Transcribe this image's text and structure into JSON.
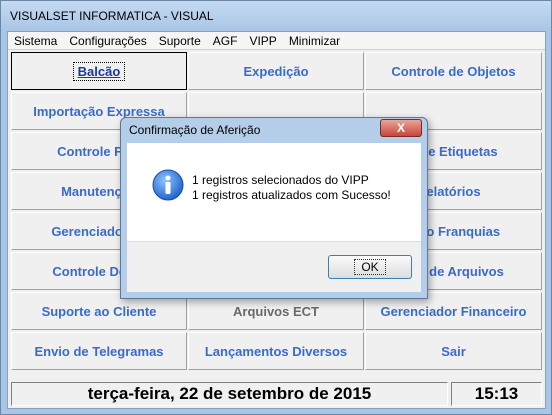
{
  "window": {
    "title": "VISUALSET INFORMATICA - VISUAL"
  },
  "menu": {
    "items": [
      {
        "label": "Sistema",
        "name": "menu-sistema"
      },
      {
        "label": "Configurações",
        "name": "menu-configuracoes"
      },
      {
        "label": "Suporte",
        "name": "menu-suporte"
      },
      {
        "label": "AGF",
        "name": "menu-agf"
      },
      {
        "label": "VIPP",
        "name": "menu-vipp"
      },
      {
        "label": "Minimizar",
        "name": "menu-minimizar"
      }
    ]
  },
  "grid": {
    "buttons": [
      {
        "label": "Balcão",
        "name": "balcao-button",
        "state": "focused"
      },
      {
        "label": "Expedição",
        "name": "expedicao-button"
      },
      {
        "label": "Controle de Objetos",
        "name": "controle-de-objetos-button"
      },
      {
        "label": "Importação Expressa",
        "name": "importacao-expressa-button"
      },
      {
        "label": "",
        "name": "empty-button-1"
      },
      {
        "label": "",
        "name": "empty-button-2"
      },
      {
        "label": "Controle Fina",
        "name": "controle-financeiro-button"
      },
      {
        "label": "",
        "name": "hidden-button-1"
      },
      {
        "label": "e de Etiquetas",
        "name": "controle-de-etiquetas-button"
      },
      {
        "label": "Manutenção",
        "name": "manutencao-button"
      },
      {
        "label": "",
        "name": "hidden-button-2"
      },
      {
        "label": "elatórios",
        "name": "relatorios-button"
      },
      {
        "label": "Gerenciador de",
        "name": "gerenciador-de-button"
      },
      {
        "label": "",
        "name": "hidden-button-3"
      },
      {
        "label": "ento Franquias",
        "name": "franquias-button"
      },
      {
        "label": "Controle De Pa",
        "name": "controle-de-pa-button"
      },
      {
        "label": "",
        "name": "hidden-button-4"
      },
      {
        "label": "são de Arquivos",
        "name": "arquivos-button"
      },
      {
        "label": "Suporte ao Cliente",
        "name": "suporte-ao-cliente-button"
      },
      {
        "label": "Arquivos ECT",
        "name": "arquivos-ect-button",
        "state": "disabled"
      },
      {
        "label": "Gerenciador Financeiro",
        "name": "gerenciador-financeiro-button"
      },
      {
        "label": "Envio de Telegramas",
        "name": "envio-de-telegramas-button"
      },
      {
        "label": "Lançamentos Diversos",
        "name": "lancamentos-diversos-button"
      },
      {
        "label": "Sair",
        "name": "sair-button"
      }
    ]
  },
  "status": {
    "date": "terça-feira, 22 de setembro de 2015",
    "time": "15:13"
  },
  "dialog": {
    "title": "Confirmação de Aferição",
    "close_label": "X",
    "line1": "1 registros selecionados do VIPP",
    "line2": "1 registros atualizados com Sucesso!",
    "ok_label": "OK",
    "icon": "info-icon"
  },
  "colors": {
    "link_blue": "#3a6bc9",
    "frame": "#a9c6e6",
    "dialog_close": "#c7463a"
  }
}
